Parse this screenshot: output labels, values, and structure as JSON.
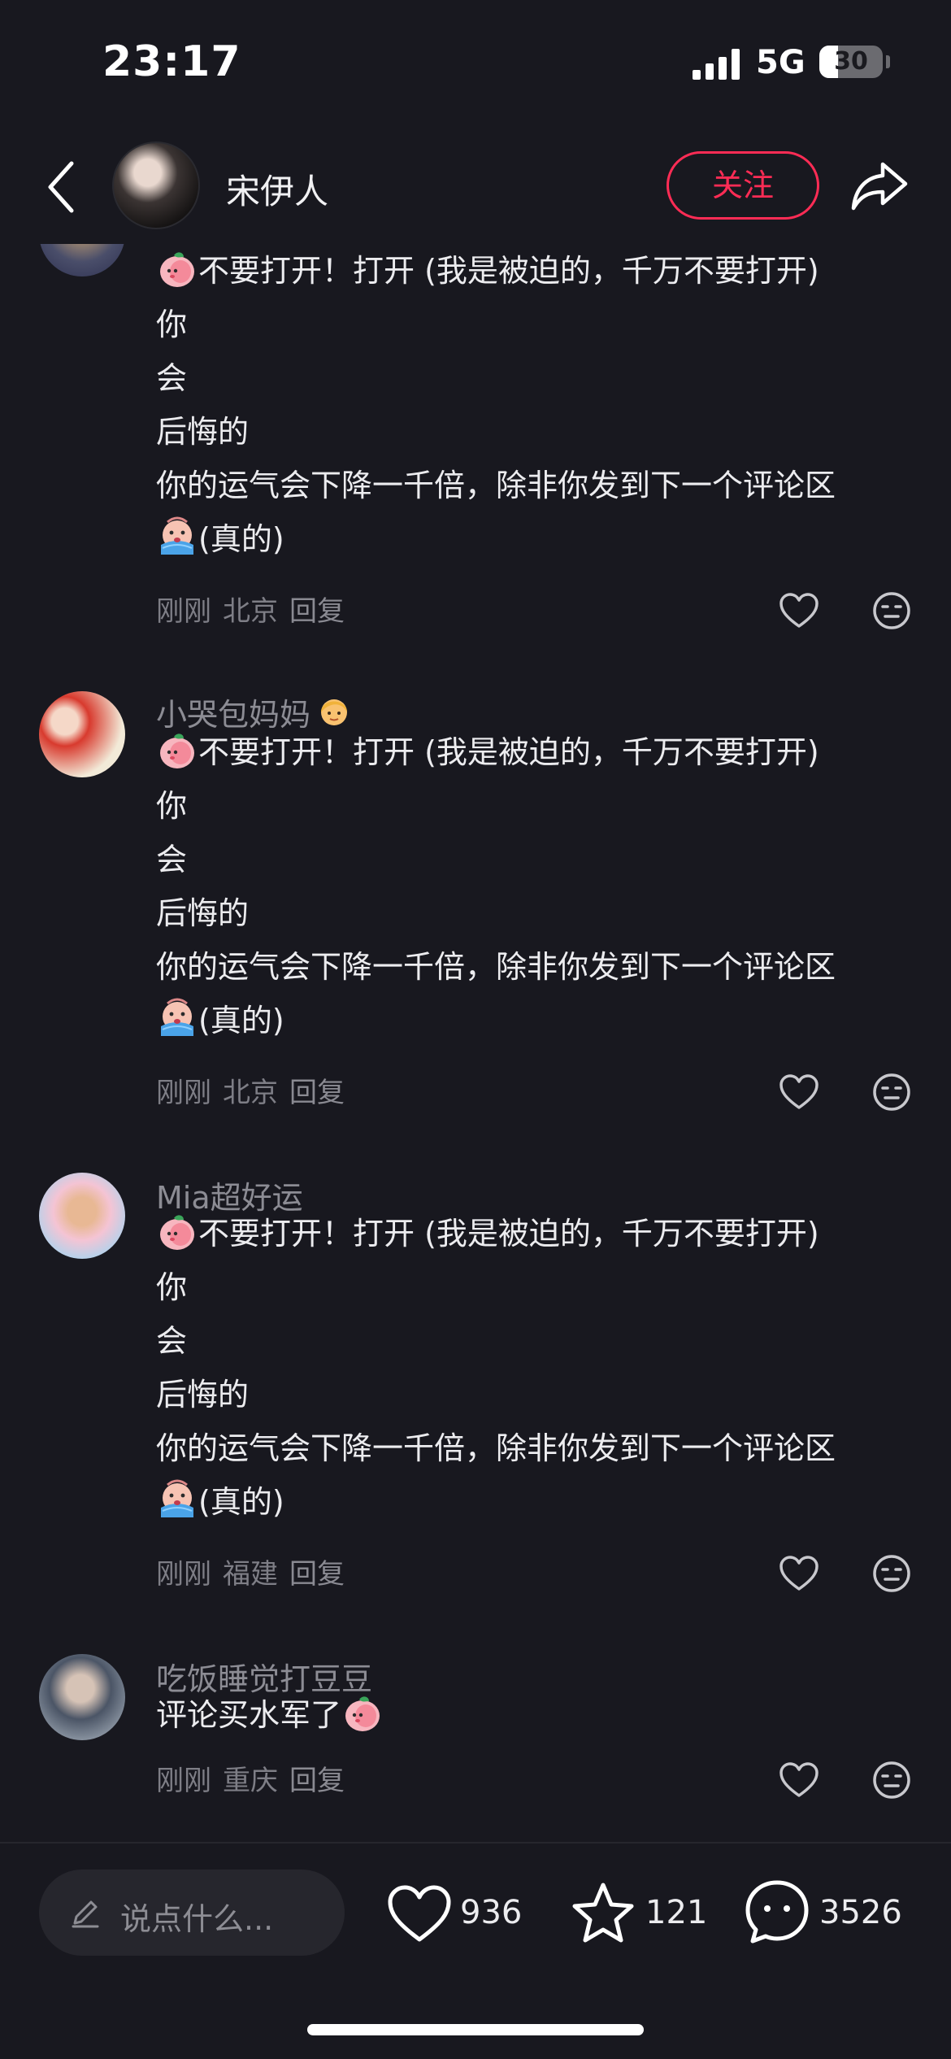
{
  "status_bar": {
    "time": "23:17",
    "network": "5G",
    "battery": "30",
    "battery_level": 0.3
  },
  "header": {
    "author_name": "宋伊人",
    "follow_label": "关注"
  },
  "comments": [
    {
      "username": "",
      "lines": [
        "不要打开！打开 (我是被迫的，千万不要打开)",
        "你",
        "会",
        "后悔的",
        "你的运气会下降一千倍，除非你发到下一个评论区",
        "(真的)"
      ],
      "time": "刚刚",
      "location": "北京",
      "reply": "回复"
    },
    {
      "username": "小哭包妈妈",
      "lines": [
        "不要打开！打开 (我是被迫的，千万不要打开)",
        "你",
        "会",
        "后悔的",
        "你的运气会下降一千倍，除非你发到下一个评论区",
        "(真的)"
      ],
      "time": "刚刚",
      "location": "北京",
      "reply": "回复"
    },
    {
      "username": "Mia超好运",
      "lines": [
        "不要打开！打开 (我是被迫的，千万不要打开)",
        "你",
        "会",
        "后悔的",
        "你的运气会下降一千倍，除非你发到下一个评论区",
        "(真的)"
      ],
      "time": "刚刚",
      "location": "福建",
      "reply": "回复"
    },
    {
      "username": "吃饭睡觉打豆豆",
      "lines": [
        "评论买水军了"
      ],
      "time": "刚刚",
      "location": "重庆",
      "reply": "回复"
    }
  ],
  "bottom_bar": {
    "input_placeholder": "说点什么...",
    "likes": "936",
    "favorites": "121",
    "comments": "3526"
  },
  "icons": {
    "back": "chevron-left-icon",
    "share": "share-arrow-icon",
    "like": "heart-icon",
    "dislike": "meh-face-icon",
    "favorite": "star-icon",
    "comment": "chat-bubble-icon",
    "edit": "pencil-icon"
  },
  "colors": {
    "background": "#18181f",
    "accent": "#ff2c55",
    "muted_text": "#8c8c94"
  }
}
